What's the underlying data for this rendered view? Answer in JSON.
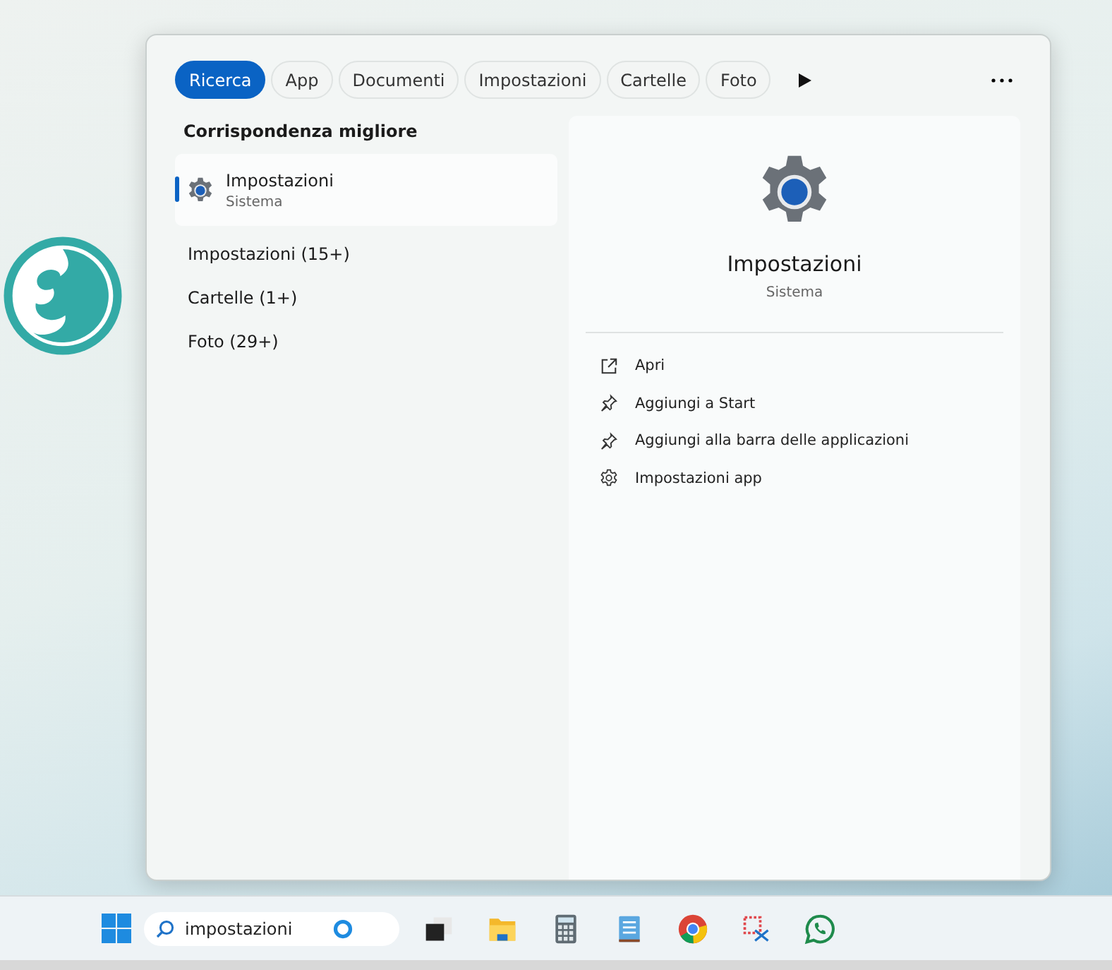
{
  "start_panel": {
    "filters": [
      {
        "label": "Ricerca",
        "selected": true
      },
      {
        "label": "App",
        "selected": false
      },
      {
        "label": "Documenti",
        "selected": false
      },
      {
        "label": "Impostazioni",
        "selected": false
      },
      {
        "label": "Cartelle",
        "selected": false
      },
      {
        "label": "Foto",
        "selected": false
      }
    ],
    "best_match": {
      "heading": "Corrispondenza migliore",
      "item": {
        "title": "Impostazioni",
        "subtitle": "Sistema",
        "selected": true
      }
    },
    "categories": [
      "Impostazioni (15+)",
      "Cartelle (1+)",
      "Foto (29+)"
    ],
    "preview": {
      "title": "Impostazioni",
      "subtitle": "Sistema",
      "actions": [
        {
          "label": "Apri",
          "kind": "open"
        },
        {
          "label": "Aggiungi a Start",
          "kind": "pin"
        },
        {
          "label": "Aggiungi alla barra delle applicazioni",
          "kind": "pin"
        },
        {
          "label": "Impostazioni app",
          "kind": "settings"
        }
      ]
    }
  },
  "taskbar": {
    "search": {
      "value": "impostazioni"
    },
    "apps": [
      {
        "kind": "taskview"
      },
      {
        "kind": "folder"
      },
      {
        "kind": "calculator"
      },
      {
        "kind": "notepad"
      },
      {
        "kind": "browser"
      },
      {
        "kind": "snip"
      },
      {
        "kind": "chat"
      }
    ]
  }
}
